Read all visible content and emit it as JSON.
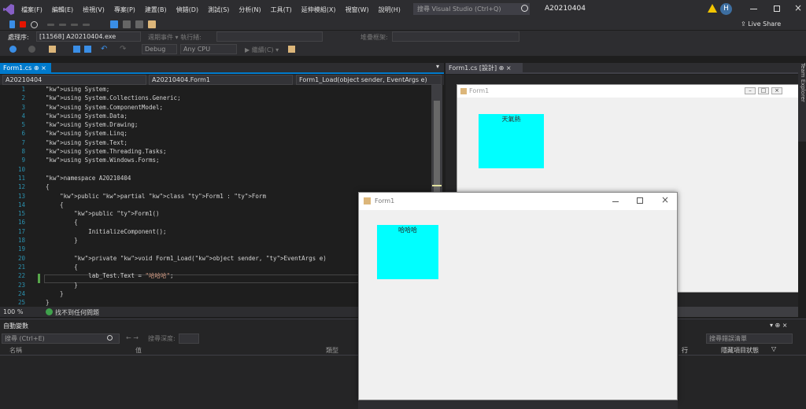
{
  "menu": [
    "檔案(F)",
    "編輯(E)",
    "檢視(V)",
    "專案(P)",
    "建置(B)",
    "偵錯(D)",
    "測試(S)",
    "分析(N)",
    "工具(T)",
    "延伸模組(X)",
    "視窗(W)",
    "說明(H)"
  ],
  "search_placeholder": "搜尋 Visual Studio (Ctrl+Q)",
  "solution_name": "A20210404",
  "user_initial": "H",
  "live_share": "Live Share",
  "process_label": "處理序:",
  "process_value": "[11568] A20210404.exe",
  "lifecycle_label": "週期事件 ▾ 執行緒:",
  "stack_label": "堆疊框架:",
  "debug_config": "Debug",
  "platform": "Any CPU",
  "continue_label": "繼續(C) ▾",
  "editor": {
    "tab_label": "Form1.cs",
    "nav_project": "A20210404",
    "nav_class": "A20210404.Form1",
    "nav_member": "Form1_Load(object sender, EventArgs e)",
    "zoom": "100 %",
    "status": "找不到任何問題"
  },
  "code": [
    {
      "n": "1",
      "t": "using System;"
    },
    {
      "n": "2",
      "t": "using System.Collections.Generic;"
    },
    {
      "n": "3",
      "t": "using System.ComponentModel;"
    },
    {
      "n": "4",
      "t": "using System.Data;"
    },
    {
      "n": "5",
      "t": "using System.Drawing;"
    },
    {
      "n": "6",
      "t": "using System.Linq;"
    },
    {
      "n": "7",
      "t": "using System.Text;"
    },
    {
      "n": "8",
      "t": "using System.Threading.Tasks;"
    },
    {
      "n": "9",
      "t": "using System.Windows.Forms;"
    },
    {
      "n": "10",
      "t": ""
    },
    {
      "n": "11",
      "t": "namespace A20210404"
    },
    {
      "n": "12",
      "t": "{"
    },
    {
      "n": "13",
      "t": "    public partial class Form1 : Form"
    },
    {
      "n": "14",
      "t": "    {"
    },
    {
      "n": "15",
      "t": "        public Form1()"
    },
    {
      "n": "16",
      "t": "        {"
    },
    {
      "n": "17",
      "t": "            InitializeComponent();"
    },
    {
      "n": "18",
      "t": "        }"
    },
    {
      "n": "19",
      "t": ""
    },
    {
      "n": "20",
      "t": "        private void Form1_Load(object sender, EventArgs e)"
    },
    {
      "n": "21",
      "t": "        {"
    },
    {
      "n": "22",
      "t": "            lab_Test.Text = \"哈哈哈\";"
    },
    {
      "n": "23",
      "t": "        }"
    },
    {
      "n": "24",
      "t": "    }"
    },
    {
      "n": "25",
      "t": "}"
    }
  ],
  "designer": {
    "tab_label": "Form1.cs [設計]",
    "form_title": "Form1",
    "label_text": "天氣熱"
  },
  "runtime": {
    "form_title": "Form1",
    "label_text": "哈哈哈"
  },
  "locals": {
    "title": "自動變數",
    "search_placeholder": "搜尋 (Ctrl+E)",
    "depth_label": "搜尋深度:",
    "columns": [
      "名稱",
      "值",
      "類型"
    ]
  },
  "errors": {
    "search_placeholder": "搜尋錯誤清單",
    "columns": [
      "行",
      "隱藏項目狀態"
    ]
  },
  "side_tab": "Team Explorer",
  "colors": {
    "cyan": "#00ffff",
    "accent": "#007acc"
  }
}
